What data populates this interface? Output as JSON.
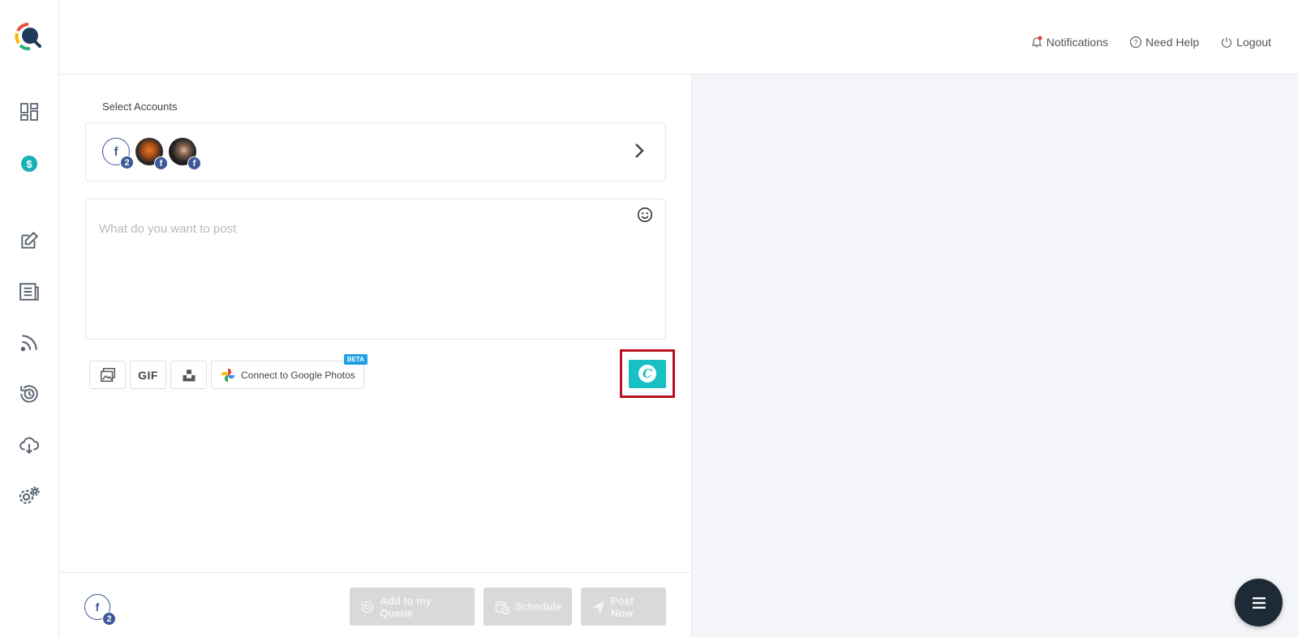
{
  "header": {
    "notifications_label": "Notifications",
    "help_label": "Need Help",
    "logout_label": "Logout"
  },
  "sidebar": {
    "items": [
      {
        "name": "dashboard",
        "icon": "dashboard-grid-icon"
      },
      {
        "name": "pricing",
        "icon": "dollar-badge-icon"
      },
      {
        "name": "compose",
        "icon": "edit-icon"
      },
      {
        "name": "posts",
        "icon": "news-list-icon"
      },
      {
        "name": "rss",
        "icon": "rss-feed-icon"
      },
      {
        "name": "history",
        "icon": "history-clock-icon"
      },
      {
        "name": "download",
        "icon": "cloud-download-icon"
      },
      {
        "name": "settings",
        "icon": "gears-icon"
      }
    ]
  },
  "compose": {
    "select_accounts_label": "Select Accounts",
    "accounts": [
      {
        "type": "facebook-group",
        "badge": "2"
      },
      {
        "type": "facebook-page-avatar-1",
        "badge": "f"
      },
      {
        "type": "facebook-page-avatar-2",
        "badge": "f"
      }
    ],
    "post_placeholder": "What do you want to post",
    "tools": {
      "gif_label": "GIF",
      "google_photos_label": "Connect to Google Photos",
      "beta_label": "BETA"
    }
  },
  "footer": {
    "selected_badge": "2",
    "add_queue_label": "Add to my Queue",
    "schedule_label": "Schedule",
    "post_now_label": "Post Now"
  },
  "colors": {
    "accent": "#18bfc4",
    "highlight_border": "#b8111e",
    "facebook": "#3b5998",
    "fab": "#1e2a36"
  }
}
